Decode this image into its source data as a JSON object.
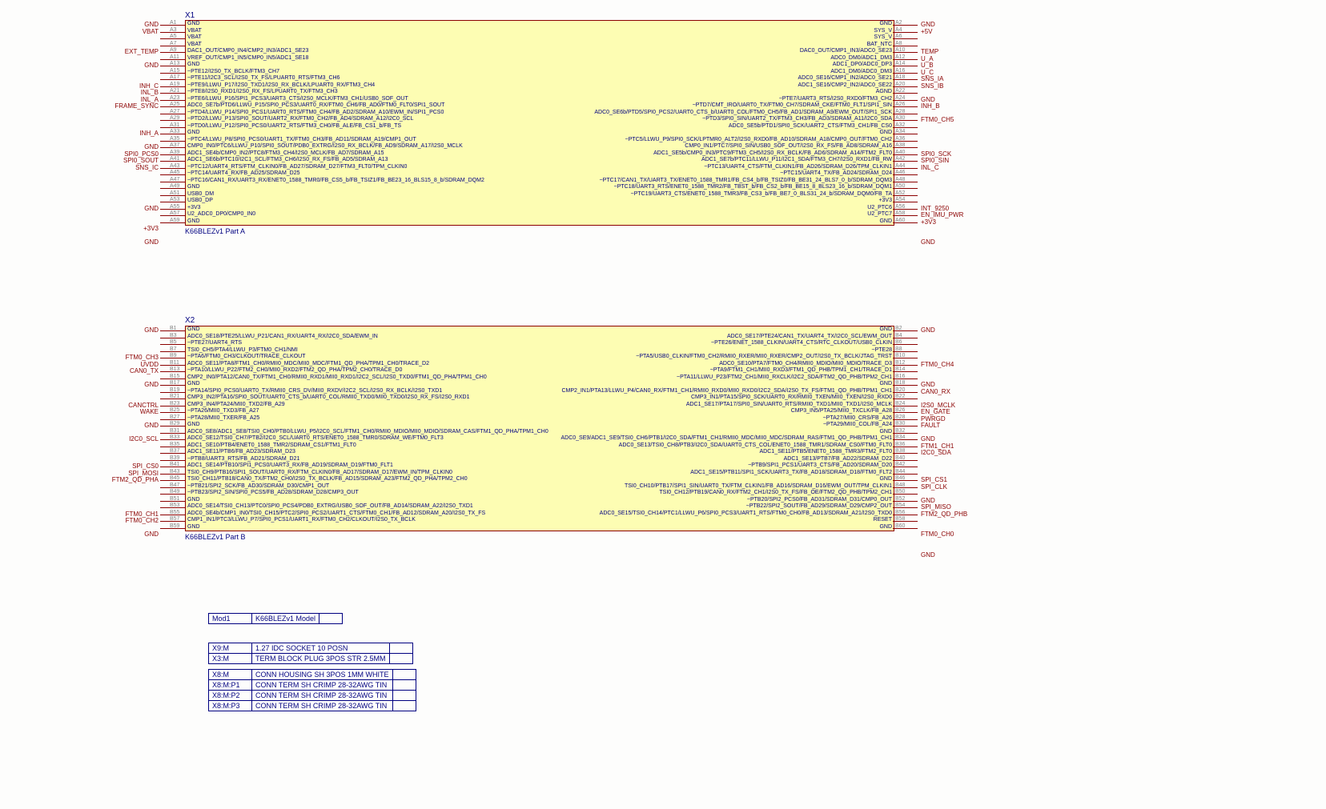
{
  "partA": {
    "ref": "X1",
    "name": "K66BLEZv1 Part A",
    "left_nets": [
      "GND",
      "VBAT",
      "",
      "",
      "EXT_TEMP",
      "",
      "GND",
      "",
      "",
      "INH_C",
      "INL_B",
      "INL_A",
      "FRAME_SYNC",
      "",
      "",
      "",
      "INH_A",
      "",
      "GND",
      "SPI0_PCS0",
      "SPI0_SOUT",
      "SNS_IC",
      "",
      "",
      "",
      "",
      "",
      "GND",
      "",
      "",
      "+3V3",
      "",
      "GND"
    ],
    "left_nums": [
      "A1",
      "A3",
      "A5",
      "A7",
      "A9",
      "A11",
      "A13",
      "A15",
      "A17",
      "A19",
      "A21",
      "A23",
      "A25",
      "A27",
      "A29",
      "A31",
      "A33",
      "A35",
      "A37",
      "A39",
      "A41",
      "A43",
      "A45",
      "A47",
      "A49",
      "A51",
      "A53",
      "A55",
      "A57",
      "A59"
    ],
    "right_nums": [
      "A2",
      "A4",
      "A6",
      "A8",
      "A10",
      "A12",
      "A14",
      "A16",
      "A18",
      "A20",
      "A22",
      "A24",
      "A26",
      "A28",
      "A30",
      "A32",
      "A34",
      "A36",
      "A38",
      "A40",
      "A42",
      "A44",
      "A46",
      "A48",
      "A50",
      "A52",
      "A54",
      "A56",
      "A58",
      "A60"
    ],
    "right_nets": [
      "GND",
      "+5V",
      "",
      "",
      "TEMP",
      "U_A",
      "U_B",
      "U_C",
      "SNS_IA",
      "SNS_IB",
      "",
      "GND",
      "INH_B",
      "",
      "FTM0_CH5",
      "",
      "",
      "",
      "",
      "SPI0_SCK",
      "SPI0_SIN",
      "INL_C",
      "",
      "",
      "",
      "",
      "",
      "INT_9250",
      "EN_IMU_PWR",
      "+3V3",
      "",
      "",
      "GND"
    ],
    "rows": [
      [
        "GND",
        "GND"
      ],
      [
        "VBAT",
        "SYS_V"
      ],
      [
        "VBAT",
        "SYS_V"
      ],
      [
        "VBAT",
        "BAT_NTC"
      ],
      [
        "DAC1_OUT/CMP0_IN4/CMP2_IN3/ADC1_SE23",
        "DAC0_OUT/CMP1_IN3/ADC0_SE23"
      ],
      [
        "VREF_OUT/CMP1_IN5/CMP0_IN5/ADC1_SE18",
        "ADC0_DM0/ADC1_DM3"
      ],
      [
        "GND",
        "ADC1_DP0/ADC0_DP3"
      ],
      [
        "~PTE12/I2S0_TX_BCLK/FTM3_CH7",
        "ADC1_DM0/ADC0_DM3"
      ],
      [
        "~PTE11/I2C3_SCL/I2S0_TX_FS/LPUART0_RTS/FTM3_CH6",
        "ADC0_SE16/CMP1_IN2/ADC0_SE21"
      ],
      [
        "~PTE9/LLWU_P17/I2S0_TXD1/I2S0_RX_BCLK/LPUART0_RX/FTM3_CH4",
        "ADC1_SE16/CMP2_IN2/ADC0_SE22"
      ],
      [
        "~PTE8/I2S0_RXD1/I2S0_RX_FS/LPUART0_TX/FTM3_CH3",
        "AGND"
      ],
      [
        "~PTE6/LLWU_P16/SPI1_PCS3/UART3_CTS/I2S0_MCLK/FTM3_CH1/USB0_SOF_OUT",
        "~PTE7/UART3_RTS/I2S0_RXD0/FTM3_CH2"
      ],
      [
        "ADC0_SE7b/PTD6/LLWU_P15/SPI0_PCS3/UART0_RX/FTM0_CH6/FB_AD0/FTM0_FLT0/SPI1_SOUT",
        "~PTD7/CMT_IRO/UART0_TX/FTM0_CH7/SDRAM_CKE/FTM0_FLT1/SPI1_SIN"
      ],
      [
        "~PTD4/LLWU_P14/SPI0_PCS1/UART0_RTS/FTM0_CH4/FB_AD2/SDRAM_A10/EWM_IN/SPI1_PCS0",
        "ADC0_SE6b/PTD5/SPI0_PCS2/UART0_CTS_b/UART0_COL/FTM0_CH5/FB_AD1/SDRAM_A9/EWM_OUT/SPI1_SCK"
      ],
      [
        "~PTD2/LLWU_P13/SPI0_SOUT/UART2_RX/FTM0_CH2/FB_AD4/SDRAM_A12/I2C0_SCL",
        "~PTD3/SPI0_SIN/UART2_TX/FTM3_CH3/FB_AD3/SDRAM_A11/I2C0_SDA"
      ],
      [
        "~PTD0/LLWU_P12/SPI0_PCS0/UART2_RTS/FTM3_CH0/FB_ALE/FB_CS1_b/FB_TS",
        "ADC0_SE5b/PTD1/SPI0_SCK/UART2_CTS/FTM3_CH1/FB_CS0"
      ],
      [
        "GND",
        "GND"
      ],
      [
        "~PTC4/LLWU_P8/SPI0_PCS0/UART1_TX/FTM0_CH3/FB_AD11/SDRAM_A19/CMP1_OUT",
        "~PTC5/LLWU_P9/SPI0_SCK/LPTMR0_ALT2/I2S0_RXD0/FB_AD10/SDRAM_A18/CMP0_OUT/FTM0_CH2"
      ],
      [
        "CMP0_IN0/PTC6/LLWU_P10/SPI0_SOUT/PDB0_EXTRG/I2S0_RX_BCLK/FB_AD9/SDRAM_A17/I2S0_MCLK",
        "CMP0_IN1/PTC7/SPI0_SIN/USB0_SOF_OUT/I2S0_RX_FS/FB_AD8/SDRAM_A16"
      ],
      [
        "ADC1_SE4b/CMP0_IN2/PTC8/FTM3_CH4/I2S0_MCLK/FB_AD7/SDRAM_A15",
        "ADC1_SE5b/CMP0_IN3/PTC9/FTM3_CH5/I2S0_RX_BCLK/FB_AD6/SDRAM_A14/FTM2_FLT0"
      ],
      [
        "ADC1_SE6b/PTC10/I2C1_SCL/FTM3_CH6/I2S0_RX_FS/FB_AD5/SDRAM_A13",
        "ADC1_SE7b/PTC11/LLWU_P11/I2C1_SDA/FTM3_CH7/I2S0_RXD1/FB_RW"
      ],
      [
        "~PTC12/UART4_RTS/FTM_CLKIN0/FB_AD27/SDRAM_D27/FTM3_FLT0/TPM_CLKIN0",
        "~PTC13/UART4_CTS/FTM_CLKIN1/FB_AD26/SDRAM_D26/TPM_CLKIN1"
      ],
      [
        "~PTC14/UART4_RX/FB_AD25/SDRAM_D25",
        "~PTC15/UART4_TX/FB_AD24/SDRAM_D24"
      ],
      [
        "~PTC16/CAN1_RX/UART3_RX/ENET0_1588_TMR0/FB_CS5_b/FB_TSIZ1/FB_BE23_16_BLS15_8_b/SDRAM_DQM2",
        "~PTC17/CAN1_TX/UART3_TX/ENET0_1588_TMR1/FB_CS4_b/FB_TSIZ0/FB_BE31_24_BLS7_0_b/SDRAM_DQM3"
      ],
      [
        "GND",
        "~PTC18/UART3_RTS/ENET0_1588_TMR2/FB_TBST_b/FB_CS2_b/FB_BE15_8_BLS23_16_b/SDRAM_DQM1"
      ],
      [
        "USB0_DM",
        "~PTC19/UART3_CTS/ENET0_1588_TMR3/FB_CS3_b/FB_BE7_0_BLS31_24_b/SDRAM_DQM0/FB_TA"
      ],
      [
        "USB0_DP",
        "+3V3"
      ],
      [
        "+3V3",
        "U2_PTC6"
      ],
      [
        "U2_ADC0_DP0/CMP0_IN0",
        "U2_PTC7"
      ],
      [
        "GND",
        "GND"
      ]
    ]
  },
  "partB": {
    "ref": "X2",
    "name": "K66BLEZv1 Part B",
    "left_nets": [
      "GND",
      "",
      "",
      "",
      "FTM0_CH3",
      "UVDD",
      "CAN0_TX",
      "",
      "GND",
      "",
      "",
      "CANCTRL",
      "WAKE",
      "",
      "GND",
      "",
      "I2C0_SCL",
      "",
      "",
      "",
      "SPI_CS0",
      "SPI_MOSI",
      "FTM2_QD_PHA",
      "",
      "",
      "",
      "",
      "FTM0_CH1",
      "FTM0_CH2",
      "",
      "GND"
    ],
    "left_nums": [
      "B1",
      "B3",
      "B5",
      "B7",
      "B9",
      "B11",
      "B13",
      "B15",
      "B17",
      "B19",
      "B21",
      "B23",
      "B25",
      "B27",
      "B29",
      "B31",
      "B33",
      "B35",
      "B37",
      "B39",
      "B41",
      "B43",
      "B45",
      "B47",
      "B49",
      "B51",
      "B53",
      "B55",
      "B57",
      "B59"
    ],
    "right_nums": [
      "B2",
      "B4",
      "B6",
      "B8",
      "B10",
      "B12",
      "B14",
      "B16",
      "B18",
      "B20",
      "B22",
      "B24",
      "B26",
      "B28",
      "B30",
      "B32",
      "B34",
      "B36",
      "B38",
      "B40",
      "B42",
      "B44",
      "B46",
      "B48",
      "B50",
      "B52",
      "B54",
      "B56",
      "B58",
      "B60"
    ],
    "right_nets": [
      "GND",
      "",
      "",
      "",
      "",
      "FTM0_CH4",
      "",
      "",
      "GND",
      "CAN0_RX",
      "",
      "I2S0_MCLK",
      "EN_GATE",
      "PWRGD",
      "FAULT",
      "",
      "GND",
      "FTM1_CH1",
      "I2C0_SDA",
      "",
      "",
      "",
      "SPI_CS1",
      "SPI_CLK",
      "",
      "GND",
      "SPI_MISO",
      "FTM2_QD_PHB",
      "",
      "",
      "FTM0_CH0",
      "",
      "",
      "GND"
    ],
    "rows": [
      [
        "GND",
        "GND"
      ],
      [
        "ADC0_SE18/PTE25/LLWU_P21/CAN1_RX/UART4_RX/I2C0_SDA/EWM_IN",
        "ADC0_SE17/PTE24/CAN1_TX/UART4_TX/I2C0_SCL/EWM_OUT"
      ],
      [
        "~PTE27/UART4_RTS",
        "~PTE26/ENET_1588_CLKIN/UART4_CTS/RTC_CLKOUT/USB0_CLKIN"
      ],
      [
        "TSI0_CH5/PTA4/LLWU_P3/FTM0_CH1/NMI",
        "~PTE28"
      ],
      [
        "~PTA6/FTM0_CH3/CLKOUT/TRACE_CLKOUT",
        "~PTA5/USB0_CLKIN/FTM0_CH2/RMII0_RXER/MII0_RXER/CMP2_OUT/I2S0_TX_BCLK/JTAG_TRST"
      ],
      [
        "ADC0_SE11/PTA8/FTM1_CH0/RMII0_MDC/MII0_MDC/FTM1_QD_PHA/TPM1_CH0/TRACE_D2",
        "ADC0_SE10/PTA7/FTM0_CH4/RMII0_MDIO/MII0_MDIO/TRACE_D3"
      ],
      [
        "~PTA10/LLWU_P22/FTM2_CH0/MII0_RXD2/FTM2_QD_PHA/TPM2_CH0/TRACE_D0",
        "~PTA9/FTM1_CH1/MII0_RXD3/FTM1_QD_PHB/TPM1_CH1/TRACE_D1"
      ],
      [
        "CMP2_IN0/PTA12/CAN0_TX/FTM1_CH0/RMII0_RXD1/MII0_RXD1/I2C2_SCL/I2S0_TXD0/FTM1_QD_PHA/TPM1_CH0",
        "~PTA11/LLWU_P23/FTM2_CH1/MII0_RXCLK/I2C2_SDA/FTM2_QD_PHB/TPM2_CH1"
      ],
      [
        "GND",
        "GND"
      ],
      [
        "~PTA14/SPI0_PCS0/UART0_TX/RMII0_CRS_DV/MII0_RXDV/I2C2_SCL/I2S0_RX_BCLK/I2S0_TXD1",
        "CMP2_IN1/PTA13/LLWU_P4/CAN0_RX/FTM1_CH1/RMII0_RXD0/MII0_RXD0/I2C2_SDA/I2S0_TX_FS/FTM1_QD_PHB/TPM1_CH1"
      ],
      [
        "CMP3_IN2/PTA16/SPI0_SOUT/UART0_CTS_b/UART0_COL/RMII0_TXD0/MII0_TXD0/I2S0_RX_FS/I2S0_RXD1",
        "CMP3_IN1/PTA15/SPI0_SCK/UART0_RX/RMII0_TXEN/MII0_TXEN/I2S0_RXD0"
      ],
      [
        "CMP3_IN4/PTA24/MII0_TXD2/FB_A29",
        "ADC1_SE17/PTA17/SPI0_SIN/UART0_RTS/RMII0_TXD1/MII0_TXD1/I2S0_MCLK"
      ],
      [
        "~PTA26/MII0_TXD3/FB_A27",
        "CMP3_IN5/PTA25/MII0_TXCLK/FB_A28"
      ],
      [
        "~PTA28/MII0_TXER/FB_A25",
        "~PTA27/MII0_CRS/FB_A26"
      ],
      [
        "GND",
        "~PTA29/MII0_COL/FB_A24"
      ],
      [
        "ADC0_SE8/ADC1_SE8/TSI0_CH0/PTB0/LLWU_P5/I2C0_SCL/FTM1_CH0/RMII0_MDIO/MII0_MDIO/SDRAM_CAS/FTM1_QD_PHA/TPM1_CH0",
        "GND"
      ],
      [
        "ADC0_SE12/TSI0_CH7/PTB2/I2C0_SCL/UART0_RTS/ENET0_1588_TMR0/SDRAM_WE/FTM0_FLT3",
        "ADC0_SE9/ADC1_SE9/TSI0_CH6/PTB1/I2C0_SDA/FTM1_CH1/RMII0_MDC/MII0_MDC/SDRAM_RAS/FTM1_QD_PHB/TPM1_CH1"
      ],
      [
        "ADC1_SE10/PTB4/ENET0_1588_TMR2/SDRAM_CS1/FTM1_FLT0",
        "ADC0_SE13/TSI0_CH8/PTB3/I2C0_SDA/UART0_CTS_COL/ENET0_1588_TMR1/SDRAM_CS0/FTM0_FLT0"
      ],
      [
        "ADC1_SE11/PTB6/FB_AD23/SDRAM_D23",
        "ADC1_SE11/PTB5/ENET0_1588_TMR3/FTM2_FLT0"
      ],
      [
        "~PTB8/UART3_RTS/FB_AD21/SDRAM_D21",
        "ADC1_SE13/PTB7/FB_AD22/SDRAM_D22"
      ],
      [
        "ADC1_SE14/PTB10/SPI1_PCS0/UART3_RX/FB_AD19/SDRAM_D19/FTM0_FLT1",
        "~PTB9/SPI1_PCS1/UART3_CTS/FB_AD20/SDRAM_D20"
      ],
      [
        "TSI0_CH9/PTB16/SPI1_SOUT/UART0_RX/FTM_CLKIN0/FB_AD17/SDRAM_D17/EWM_IN/TPM_CLKIN0",
        "ADC1_SE15/PTB11/SPI1_SCK/UART3_TX/FB_AD18/SDRAM_D18/FTM0_FLT2"
      ],
      [
        "TSI0_CH11/PTB18/CAN0_TX/FTM2_CH0/I2S0_TX_BCLK/FB_AD15/SDRAM_A23/FTM2_QD_PHA/TPM2_CH0",
        "GND"
      ],
      [
        "~PTB21/SPI2_SCK/FB_AD30/SDRAM_D30/CMP1_OUT",
        "TSI0_CH10/PTB17/SPI1_SIN/UART0_TX/FTM_CLKIN1/FB_AD16/SDRAM_D16/EWM_OUT/TPM_CLKIN1"
      ],
      [
        "~PTB23/SPI2_SIN/SPI0_PCS5/FB_AD28/SDRAM_D28/CMP3_OUT",
        "TSI0_CH12/PTB19/CAN0_RX/FTM2_CH1/I2S0_TX_FS/FB_OE/FTM2_QD_PHB/TPM2_CH1"
      ],
      [
        "GND",
        "~PTB20/SPI2_PCS0/FB_AD31/SDRAM_D31/CMP0_OUT"
      ],
      [
        "ADC0_SE14/TSI0_CH13/PTC0/SPI0_PCS4/PDB0_EXTRG/USB0_SOF_OUT/FB_AD14/SDRAM_A22/I2S0_TXD1",
        "~PTB22/SPI2_SOUT/FB_AD29/SDRAM_D29/CMP2_OUT"
      ],
      [
        "ADC0_SE4b/CMP1_IN0/TSI0_CH15/PTC2/SPI0_PCS2/UART1_CTS/FTM0_CH1/FB_AD12/SDRAM_A20/I2S0_TX_FS",
        "ADC0_SE15/TSI0_CH14/PTC1/LLWU_P6/SPI0_PCS3/UART1_RTS/FTM0_CH0/FB_AD13/SDRAM_A21/I2S0_TXD0"
      ],
      [
        "CMP1_IN1/PTC3/LLWU_P7/SPI0_PCS1/UART1_RX/FTM0_CH2/CLKOUT/I2S0_TX_BCLK",
        "RESET"
      ],
      [
        "GND",
        "GND"
      ]
    ]
  },
  "bom1": [
    [
      "Mod1",
      "K66BLEZv1 Model"
    ]
  ],
  "bom2": [
    [
      "X9:M",
      "1.27 IDC SOCKET 10 POSN"
    ],
    [
      "X3:M",
      "TERM BLOCK PLUG 3POS STR 2.5MM"
    ]
  ],
  "bom3": [
    [
      "X8:M",
      "CONN HOUSING SH 3POS 1MM WHITE"
    ],
    [
      "X8:M:P1",
      "CONN TERM SH CRIMP 28-32AWG TIN"
    ],
    [
      "X8:M:P2",
      "CONN TERM SH CRIMP 28-32AWG TIN"
    ],
    [
      "X8:M:P3",
      "CONN TERM SH CRIMP 28-32AWG TIN"
    ]
  ]
}
